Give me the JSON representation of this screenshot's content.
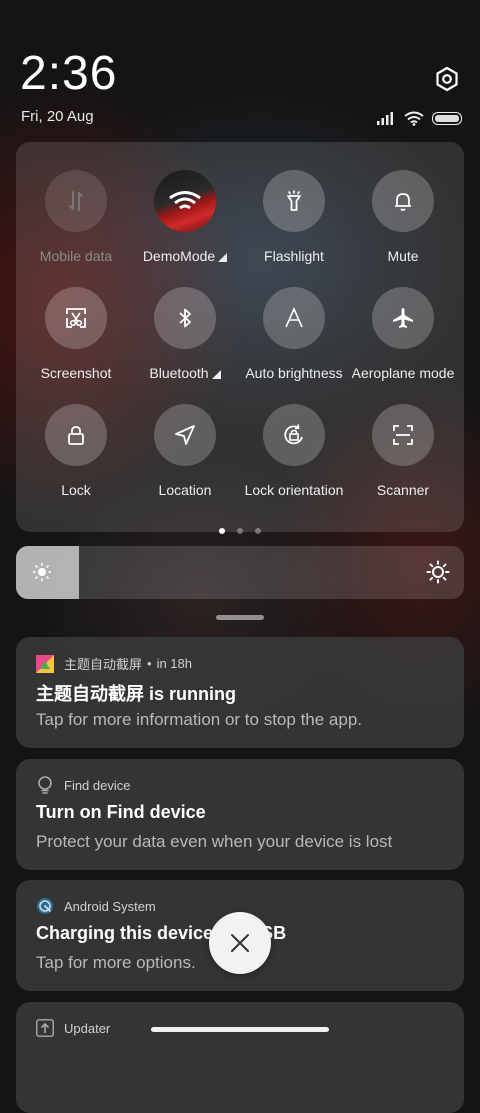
{
  "status": {
    "time": "2:36",
    "date": "Fri, 20 Aug"
  },
  "tiles": [
    {
      "label": "Mobile data",
      "icon": "mobile-data-icon",
      "state": "disabled"
    },
    {
      "label": "DemoMode",
      "icon": "demomode-avatar",
      "state": "on",
      "expandable": true
    },
    {
      "label": "Flashlight",
      "icon": "flashlight-icon",
      "state": "off"
    },
    {
      "label": "Mute",
      "icon": "bell-icon",
      "state": "off"
    },
    {
      "label": "Screenshot",
      "icon": "screenshot-icon",
      "state": "off"
    },
    {
      "label": "Bluetooth",
      "icon": "bluetooth-icon",
      "state": "off",
      "expandable": true
    },
    {
      "label": "Auto brightness",
      "icon": "auto-brightness-icon",
      "state": "off"
    },
    {
      "label": "Aeroplane mode",
      "icon": "airplane-icon",
      "state": "off"
    },
    {
      "label": "Lock",
      "icon": "lock-icon",
      "state": "off"
    },
    {
      "label": "Location",
      "icon": "location-icon",
      "state": "off"
    },
    {
      "label": "Lock orientation",
      "icon": "lock-orientation-icon",
      "state": "off"
    },
    {
      "label": "Scanner",
      "icon": "scanner-icon",
      "state": "off"
    }
  ],
  "pager": {
    "pages": 3,
    "current": 1
  },
  "brightness": {
    "level": 0.14
  },
  "notifications": [
    {
      "app": "主题自动截屏",
      "time": "in 18h",
      "title": "主题自动截屏 is running",
      "body": "Tap for more information or to stop the app."
    },
    {
      "app": "Find device",
      "title": "Turn on Find device",
      "body": "Protect your data even when your device is lost"
    },
    {
      "app": "Android System",
      "title": "Charging this device via USB",
      "body": "Tap for more options."
    },
    {
      "app": "Updater"
    }
  ],
  "colors": {
    "accent": "#ffffff",
    "panel": "#3c3c3c"
  }
}
